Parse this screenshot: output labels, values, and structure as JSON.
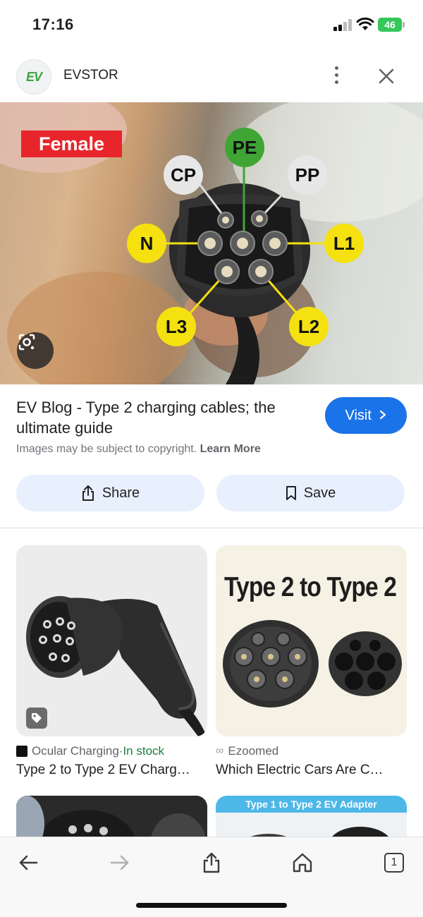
{
  "status_bar": {
    "time": "17:16",
    "battery": "46",
    "icons": [
      "signal-icon",
      "wifi-icon",
      "battery-charging-icon"
    ]
  },
  "source_header": {
    "logo_text": "EV",
    "name": "EVSTOR",
    "icons": [
      "more-vert-icon",
      "close-icon"
    ]
  },
  "hero": {
    "tag": "Female",
    "pins": {
      "pe": "PE",
      "cp": "CP",
      "pp": "PP",
      "n": "N",
      "l1": "L1",
      "l3": "L3",
      "l2": "L2"
    },
    "lens_icon": "google-lens-icon"
  },
  "result": {
    "title": "EV Blog - Type 2 charging cables; the ultimate guide",
    "visit_label": "Visit",
    "copyright_text": "Images may be subject to copyright.",
    "learn_more": "Learn More",
    "share_label": "Share",
    "save_label": "Save"
  },
  "grid": [
    {
      "source": "Ocular Charging",
      "separator": " · ",
      "stock": "In stock",
      "title": "Type 2 to Type 2 EV Charg…"
    },
    {
      "source": "Ezoomed",
      "image_text": "Type 2 to Type 2",
      "title": "Which Electric Cars Are C…"
    }
  ],
  "peek": {
    "right_banner": "Type 1 to Type 2 EV Adapter"
  },
  "toolbar": {
    "tab_count": "1",
    "icons": [
      "back-icon",
      "forward-icon",
      "share-icon",
      "home-icon",
      "tabs-icon"
    ]
  },
  "colors": {
    "accent_blue": "#1a73e8",
    "action_bg": "#e8f0fe",
    "female_red": "#e8252b",
    "pin_yellow": "#f4e10f",
    "pin_green": "#3fa535",
    "battery_green": "#34c759"
  }
}
